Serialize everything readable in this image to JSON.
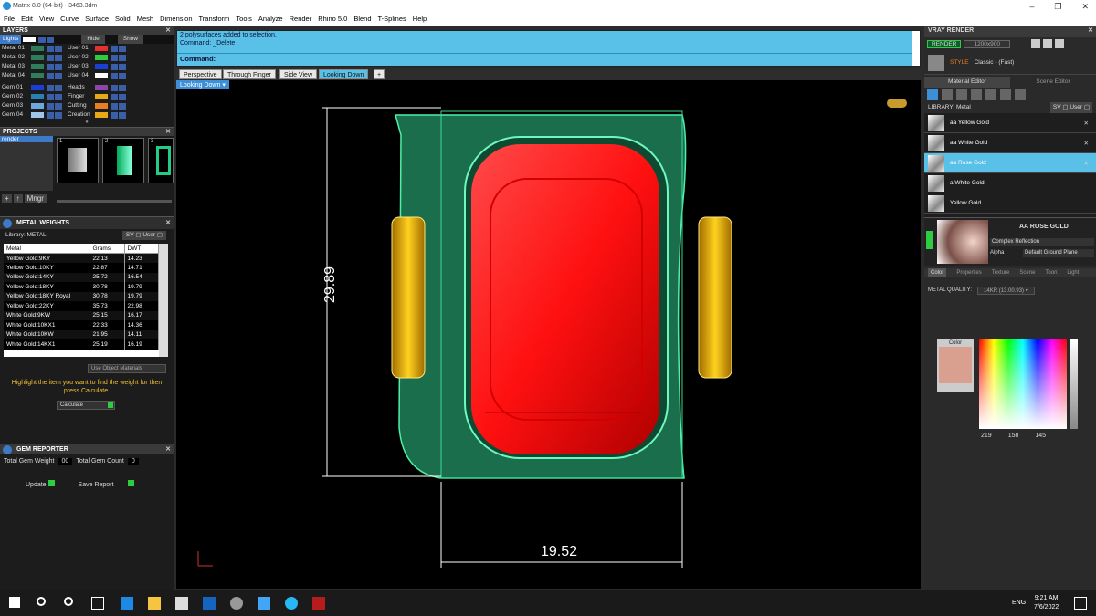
{
  "window": {
    "title": "Matrix 8.0 (64-bit) - 3463.3dm"
  },
  "menu": [
    "File",
    "Edit",
    "View",
    "Curve",
    "Surface",
    "Solid",
    "Mesh",
    "Dimension",
    "Transform",
    "Tools",
    "Analyze",
    "Render",
    "Rhino 5.0",
    "Blend",
    "T-Splines",
    "Help"
  ],
  "layers": {
    "title": "LAYERS",
    "top_label": "Lights",
    "hide": "Hide",
    "show": "Show",
    "rows": [
      {
        "a": "Metal 01",
        "ac": "#2e7d5b",
        "b": "User 01",
        "bc": "#e53030"
      },
      {
        "a": "Metal 02",
        "ac": "#2e7d5b",
        "b": "User 02",
        "bc": "#2ecc40"
      },
      {
        "a": "Metal 03",
        "ac": "#2e7d5b",
        "b": "User 03",
        "bc": "#1a3fd6"
      },
      {
        "a": "Metal 04",
        "ac": "#2e7d5b",
        "b": "User 04",
        "bc": "#ffffff"
      },
      {
        "a": "Gem 01",
        "ac": "#1a3fd6",
        "b": "Heads",
        "bc": "#8e44ad"
      },
      {
        "a": "Gem 02",
        "ac": "#2980b9",
        "b": "Finger",
        "bc": "#e6a817"
      },
      {
        "a": "Gem 03",
        "ac": "#6fa8dc",
        "b": "Cutting",
        "bc": "#e67e22"
      },
      {
        "a": "Gem 04",
        "ac": "#9fc5e8",
        "b": "Creation",
        "bc": "#e6a817"
      }
    ]
  },
  "projects": {
    "title": "PROJECTS",
    "item": "render",
    "thumbs": [
      "1",
      "2",
      "3"
    ],
    "mngr": "Mngr"
  },
  "metal": {
    "title": "METAL WEIGHTS",
    "library": "Library: METAL",
    "headers": [
      "Metal",
      "Grams",
      "DWT"
    ],
    "rows": [
      [
        "Yellow Gold:9KY",
        "22.13",
        "14.23"
      ],
      [
        "Yellow Gold:10KY",
        "22.87",
        "14.71"
      ],
      [
        "Yellow Gold:14KY",
        "25.72",
        "16.54"
      ],
      [
        "Yellow Gold:18KY",
        "30.78",
        "19.79"
      ],
      [
        "Yellow Gold:18KY Royal",
        "30.78",
        "19.79"
      ],
      [
        "Yellow Gold:22KY",
        "35.73",
        "22.98"
      ],
      [
        "White Gold:9KW",
        "25.15",
        "16.17"
      ],
      [
        "White Gold:10KX1",
        "22.33",
        "14.36"
      ],
      [
        "White Gold:10KW",
        "21.95",
        "14.11"
      ],
      [
        "White Gold:14KX1",
        "25.19",
        "16.19"
      ]
    ],
    "use_obj": "Use Object Materials",
    "hint": "Highlight the item you want to find the weight for then press Calculate.",
    "calc": "Calculate"
  },
  "gem": {
    "title": "GEM REPORTER",
    "tgw": "Total Gem Weight",
    "tgw_val": "00",
    "tgc": "Total Gem Count",
    "tgc_val": "0",
    "update": "Update",
    "save": "Save Report"
  },
  "command": {
    "line1": "2 polysurfaces added to selection.",
    "line2": "Command: _Delete",
    "prompt": "Command:"
  },
  "tabs": [
    "Perspective",
    "Through Finger",
    "Side View",
    "Looking Down"
  ],
  "viewport": {
    "name": "Looking Down",
    "dim_h": "29.89",
    "dim_w": "19.52"
  },
  "vray": {
    "title": "VRAY RENDER",
    "render": "RENDER",
    "res": "1200x900",
    "style_label": "STYLE",
    "style": "Classic - (Fast)",
    "tab1": "Material Editor",
    "tab2": "Scene Editor",
    "library": "LIBRARY: Metal",
    "materials": [
      "aa Yellow Gold",
      "aa White Gold",
      "aa Rose Gold",
      "a White Gold",
      "Yellow Gold"
    ],
    "selected_mat": "AA ROSE GOLD",
    "reflection": "Complex Reflection",
    "alpha": "Alpha",
    "ground": "Default Ground Plane",
    "prop_tabs": [
      "Color",
      "Properties",
      "Texture",
      "Scene",
      "Toon",
      "Light"
    ],
    "quality_label": "METAL QUALITY:",
    "quality": "14KR",
    "quality2": "(13.00.93)",
    "color_label": "Color",
    "swatch": "#d9a08f",
    "rgb": [
      "219",
      "158",
      "145"
    ]
  },
  "taskbar": {
    "time": "9:21 AM",
    "date": "7/6/2022",
    "lang": "ENG"
  }
}
